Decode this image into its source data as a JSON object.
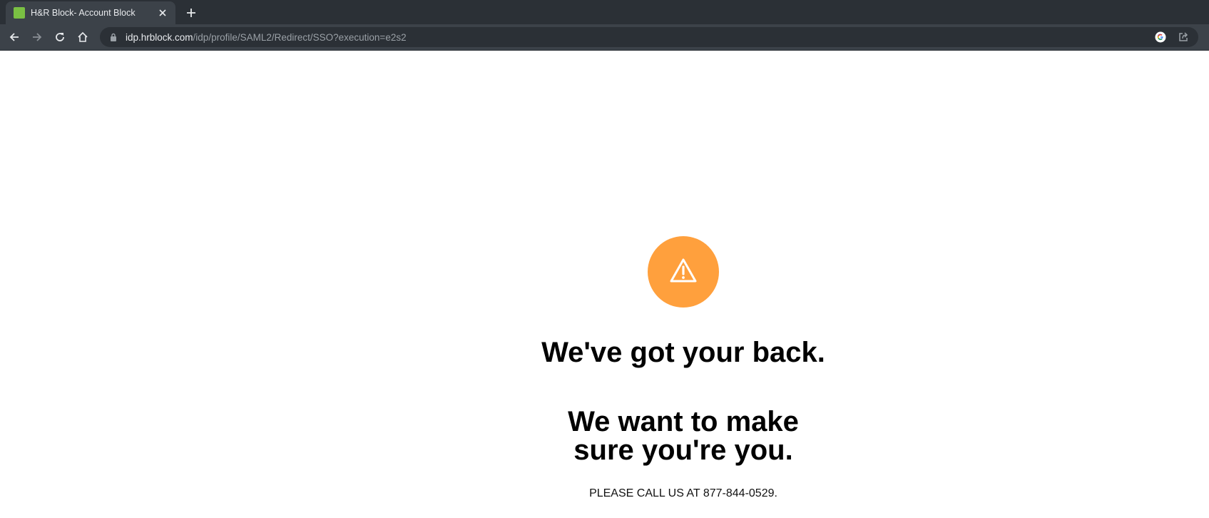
{
  "browser": {
    "tab": {
      "title": "H&R Block- Account Block",
      "favicon_color": "#7ac043"
    },
    "address_bar": {
      "host": "idp.hrblock.com",
      "path": "/idp/profile/SAML2/Redirect/SSO?execution=e2s2"
    },
    "icons": {
      "back": "back-arrow-icon",
      "forward": "forward-arrow-icon",
      "reload": "reload-icon",
      "home": "home-icon",
      "lock": "lock-icon",
      "google": "google-icon",
      "share": "share-icon",
      "close": "close-icon",
      "new_tab": "plus-icon"
    }
  },
  "page": {
    "alert_color": "#ffa03d",
    "alert_icon": "warning-triangle-icon",
    "headline_1": "We've got your back.",
    "headline_2": "We want to make sure you're you.",
    "call_text": "PLEASE CALL US AT 877-844-0529."
  }
}
